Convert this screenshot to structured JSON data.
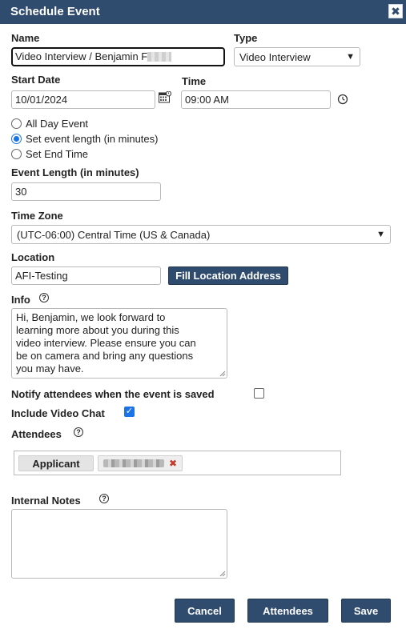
{
  "dialog": {
    "title": "Schedule Event",
    "close_glyph": "✖"
  },
  "name": {
    "label": "Name",
    "value": "Video Interview / Benjamin F"
  },
  "type": {
    "label": "Type",
    "selected": "Video Interview"
  },
  "start_date": {
    "label": "Start Date",
    "value": "10/01/2024"
  },
  "time": {
    "label": "Time",
    "value": "09:00 AM"
  },
  "duration_mode": {
    "options": [
      "All Day Event",
      "Set event length (in minutes)",
      "Set End Time"
    ],
    "selected_index": 1
  },
  "event_length": {
    "label": "Event Length (in minutes)",
    "value": "30"
  },
  "time_zone": {
    "label": "Time Zone",
    "selected": "(UTC-06:00) Central Time (US & Canada)"
  },
  "location": {
    "label": "Location",
    "value": "AFI-Testing",
    "fill_button": "Fill Location Address"
  },
  "info": {
    "label": "Info",
    "help": "?",
    "lines": [
      "Hi, Benjamin, we look forward to",
      "learning more about you during this",
      "video interview. Please ensure you can",
      "be on camera and bring any questions",
      "you may have."
    ]
  },
  "notify": {
    "label": "Notify attendees when the event is saved",
    "checked": false
  },
  "video_chat": {
    "label": "Include Video Chat",
    "checked": true,
    "check_glyph": "✓"
  },
  "attendees": {
    "label": "Attendees",
    "help": "?",
    "role_tag": "Applicant",
    "remove_glyph": "✖"
  },
  "internal_notes": {
    "label": "Internal Notes",
    "help": "?",
    "value": ""
  },
  "footer": {
    "cancel": "Cancel",
    "attendees": "Attendees",
    "save": "Save"
  },
  "colors": {
    "header": "#2f4b6e",
    "button": "#2f4b6e",
    "check": "#1a73e8",
    "remove": "#c0392b"
  },
  "icons": {
    "date": "calendar-icon",
    "time": "clock-icon",
    "help": "help-icon",
    "close": "close-icon"
  }
}
